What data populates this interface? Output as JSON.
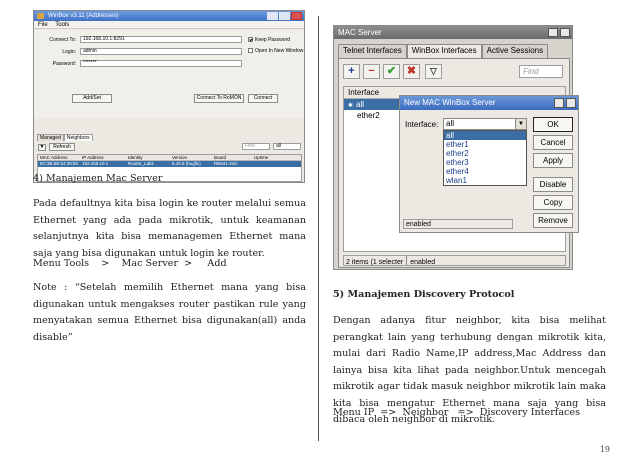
{
  "winbox": {
    "title": "WinBox v3.11 (Addresses)",
    "menu": [
      "File",
      "Tools"
    ],
    "connect_to_label": "Connect To:",
    "connect_to_value": "192.168.10.1:8291",
    "login_label": "Login:",
    "login_value": "admin",
    "password_label": "Password:",
    "password_value": "*******",
    "keep_password": "Keep Password",
    "open_new_window": "Open In New Window",
    "add_set_button": "Add/Set",
    "connect_romon_button": "Connect To RoMON",
    "connect_button": "Connect",
    "tabs": [
      "Managed",
      "Neighbors"
    ],
    "refresh_button": "Refresh",
    "find_placeholder": "Find",
    "filter_value": "all",
    "table": {
      "columns": [
        "MAC Address",
        "IP Address",
        "Identity",
        "Version",
        "Board",
        "Uptime"
      ],
      "rows": [
        [
          "6C:3B:6B:54:39:50",
          "192.168.10.1",
          "Router_Lab1",
          "6.40.5 (bugfix)",
          "RB941-2nD",
          ""
        ]
      ]
    }
  },
  "left_text": {
    "heading": "4) Manajemen Mac Server",
    "para1": "Pada defaultnya kita bisa login ke router melalui semua Ethernet yang ada pada mikrotik, untuk keamanan selanjutnya kita bisa memanagemen  Ethernet mana saja yang bisa digunakan untuk login ke router.",
    "menu_path": "Menu Tools    >    Mac Server  >     Add",
    "note": "Note : “Setelah memilih Ethernet mana yang bisa digunakan untuk mengakses router pastikan rule yang menyatakan semua Ethernet bisa digunakan(all) anda disable”"
  },
  "mac_server": {
    "title": "MAC Server",
    "tabs": [
      "Telnet Interfaces",
      "WinBox Interfaces",
      "Active Sessions"
    ],
    "find_placeholder": "Find",
    "list_header": "Interface",
    "rows": [
      "all",
      "ether2"
    ],
    "status_count": "2 items (1 selecter",
    "status_state": "enabled"
  },
  "new_server_dialog": {
    "title": "New MAC WinBox Server",
    "interface_label": "Interface:",
    "interface_value": "all",
    "options": [
      "all",
      "ether1",
      "ether2",
      "ether3",
      "ether4",
      "wlan1"
    ],
    "buttons": [
      "OK",
      "Cancel",
      "Apply",
      "Disable",
      "Copy",
      "Remove"
    ],
    "status": "enabled"
  },
  "right_text": {
    "heading": "5) Manajemen Discovery Protocol",
    "para1": "Dengan adanya fitur neighbor, kita bisa melihat perangkat lain yang terhubung dengan mikrotik kita, mulai dari Radio Name,IP  address,Mac Address dan lainya bisa kita lihat pada neighbor.Untuk mencegah mikrotik agar tidak masuk neighbor mikrotik lain maka kita bisa mengatur Ethernet mana saja yang bisa dibaca oleh neighbor di mikrotik.",
    "menu_path": "Menu IP  =>  Neighbor   =>  Discovery Interfaces"
  },
  "page_number": "19"
}
